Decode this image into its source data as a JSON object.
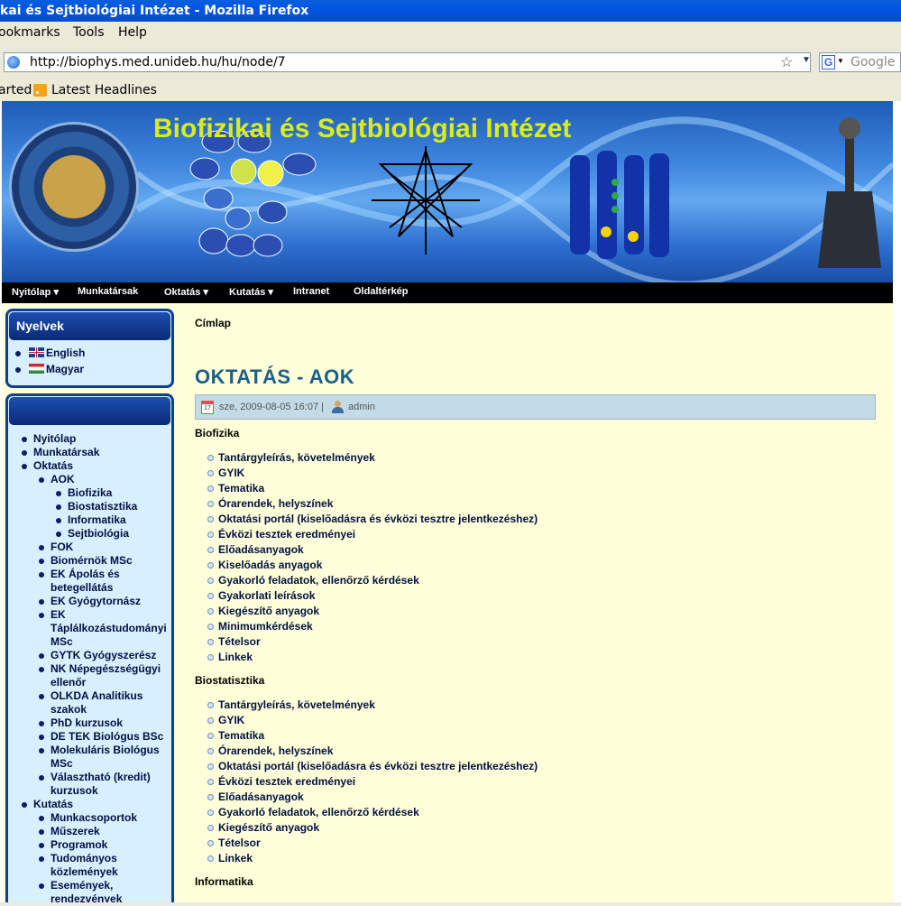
{
  "browser": {
    "window_title": "kai és Sejtbiológiai Intézet - Mozilla Firefox",
    "menu": [
      "ookmarks",
      "Tools",
      "Help"
    ],
    "url": "http://biophys.med.unideb.hu/hu/node/7",
    "search_placeholder": "Google",
    "bookmarks": [
      "arted",
      "Latest Headlines"
    ]
  },
  "site": {
    "title": "Biofizikai és Sejtbiológiai Intézet",
    "nav": [
      "Nyitólap ▾",
      "Munkatársak",
      "Oktatás ▾",
      "Kutatás ▾",
      "Intranet",
      "Oldaltérkép"
    ]
  },
  "languages": {
    "title": "Nyelvek",
    "items": [
      "English",
      "Magyar"
    ]
  },
  "sidebar_nav": [
    {
      "label": "Nyitólap",
      "level": 0
    },
    {
      "label": "Munkatársak",
      "level": 0
    },
    {
      "label": "Oktatás",
      "level": 0
    },
    {
      "label": "AOK",
      "level": 1
    },
    {
      "label": "Biofizika",
      "level": 2
    },
    {
      "label": "Biostatisztika",
      "level": 2
    },
    {
      "label": "Informatika",
      "level": 2
    },
    {
      "label": "Sejtbiológia",
      "level": 2
    },
    {
      "label": "FOK",
      "level": 1
    },
    {
      "label": "Biomérnök MSc",
      "level": 1
    },
    {
      "label": "EK Ápolás és",
      "level": 1,
      "cont": "betegellátás"
    },
    {
      "label": "EK Gyógytornász",
      "level": 1
    },
    {
      "label": "EK",
      "level": 1,
      "cont": "Táplálkozástudományi",
      "cont2": "MSc"
    },
    {
      "label": "GYTK Gyógyszerész",
      "level": 1
    },
    {
      "label": "NK Népegészségügyi",
      "level": 1,
      "cont": "ellenőr"
    },
    {
      "label": "OLKDA Analitikus",
      "level": 1,
      "cont": "szakok"
    },
    {
      "label": "PhD kurzusok",
      "level": 1
    },
    {
      "label": "DE TEK Biológus BSc",
      "level": 1
    },
    {
      "label": "Molekuláris Biológus",
      "level": 1,
      "cont": "MSc"
    },
    {
      "label": "Választható (kredit)",
      "level": 1,
      "cont": "kurzusok"
    },
    {
      "label": "Kutatás",
      "level": 0
    },
    {
      "label": "Munkacsoportok",
      "level": 1
    },
    {
      "label": "Műszerek",
      "level": 1
    },
    {
      "label": "Programok",
      "level": 1
    },
    {
      "label": "Tudományos",
      "level": 1,
      "cont": "közlemények"
    },
    {
      "label": "Események,",
      "level": 1,
      "cont": "rendezvények"
    }
  ],
  "main": {
    "breadcrumb": "Címlap",
    "title": "OKTATÁS - AOK",
    "date": "sze, 2009-08-05 16:07 |",
    "author": "admin",
    "sections": [
      {
        "heading": "Biofizika",
        "items": [
          "Tantárgyleírás, követelmények",
          "GYIK",
          "Tematika",
          "Órarendek, helyszínek",
          "Oktatási portál (kiselőadásra és évközi tesztre jelentkezéshez)",
          "Évközi tesztek eredményei",
          "Előadásanyagok",
          "Kiselőadás anyagok",
          "Gyakorló feladatok, ellenőrző kérdések",
          "Gyakorlati leírások",
          "Kiegészítő anyagok",
          "Minimumkérdések",
          "Tételsor",
          "Linkek"
        ]
      },
      {
        "heading": "Biostatisztika",
        "items": [
          "Tantárgyleírás, követelmények",
          "GYIK",
          "Tematika",
          "Órarendek, helyszínek",
          "Oktatási portál (kiselőadásra és évközi tesztre jelentkezéshez)",
          "Évközi tesztek eredményei",
          "Előadásanyagok",
          "Gyakorló feladatok, ellenőrző kérdések",
          "Kiegészítő anyagok",
          "Tételsor",
          "Linkek"
        ]
      },
      {
        "heading": "Informatika",
        "items": []
      }
    ]
  },
  "colors": {
    "title_yellow": "#d8ec1e",
    "content_bg": "#ffffd9",
    "block_bg": "#d7efff",
    "block_header": "#0a2a78",
    "node_title": "#1c5f8a"
  }
}
